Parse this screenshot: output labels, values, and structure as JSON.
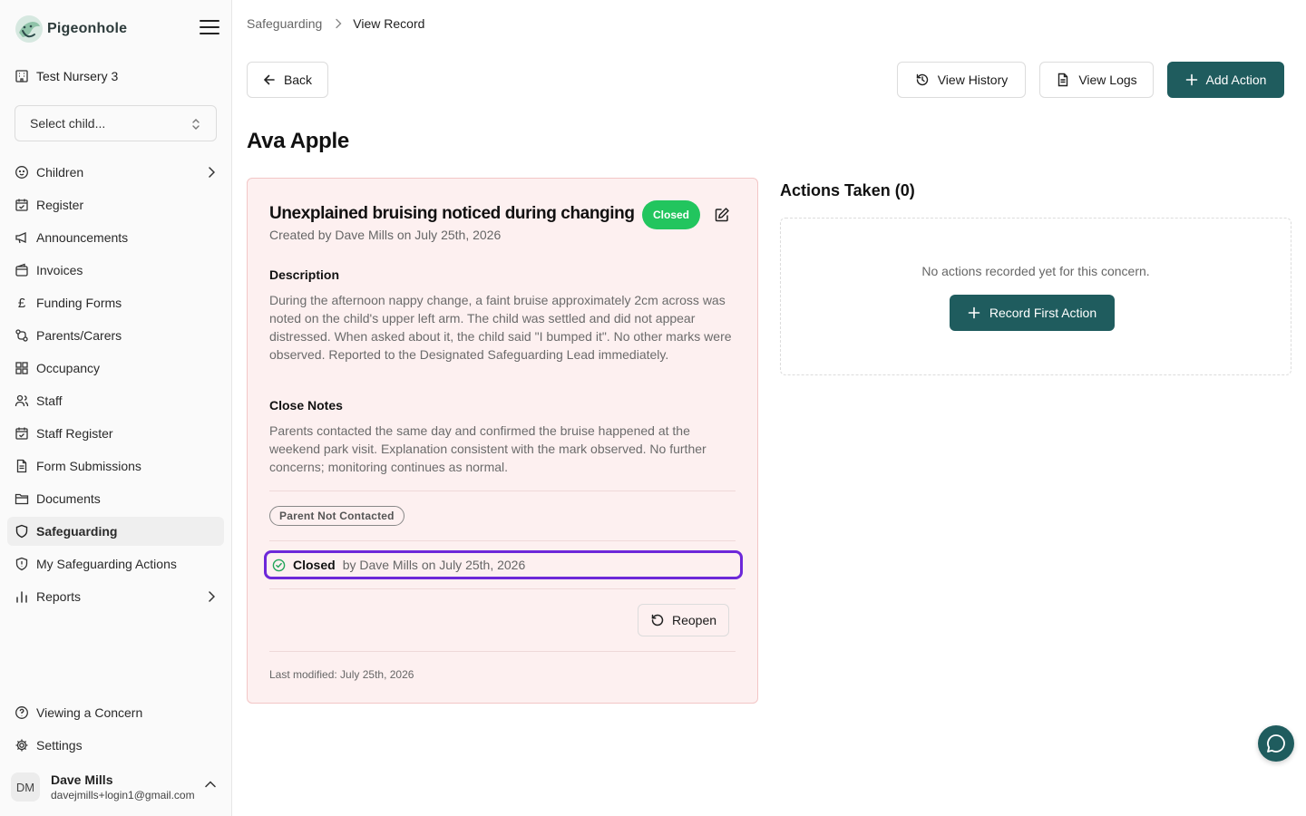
{
  "app": {
    "name": "Pigeonhole",
    "accent": "#1f5c5e"
  },
  "sidebar": {
    "nursery": "Test Nursery 3",
    "child_select_placeholder": "Select child...",
    "items": [
      {
        "label": "Children",
        "icon": "baby-icon",
        "has_submenu": true
      },
      {
        "label": "Register",
        "icon": "calendar-check-icon"
      },
      {
        "label": "Announcements",
        "icon": "megaphone-icon"
      },
      {
        "label": "Invoices",
        "icon": "wallet-icon"
      },
      {
        "label": "Funding Forms",
        "icon": "pound-icon"
      },
      {
        "label": "Parents/Carers",
        "icon": "connection-icon"
      },
      {
        "label": "Occupancy",
        "icon": "grid-icon"
      },
      {
        "label": "Staff",
        "icon": "users-icon"
      },
      {
        "label": "Staff Register",
        "icon": "calendar-check-icon"
      },
      {
        "label": "Form Submissions",
        "icon": "document-icon"
      },
      {
        "label": "Documents",
        "icon": "folder-icon"
      },
      {
        "label": "Safeguarding",
        "icon": "shield-icon",
        "active": true
      },
      {
        "label": "My Safeguarding Actions",
        "icon": "shield-alert-icon"
      },
      {
        "label": "Reports",
        "icon": "bar-chart-icon",
        "has_submenu": true
      }
    ],
    "bottom_items": [
      {
        "label": "Viewing a Concern",
        "icon": "help-circle-icon"
      },
      {
        "label": "Settings",
        "icon": "gear-icon"
      }
    ],
    "user": {
      "initials": "DM",
      "name": "Dave Mills",
      "email": "davejmills+login1@gmail.com"
    }
  },
  "breadcrumb": {
    "parent": "Safeguarding",
    "current": "View Record"
  },
  "toolbar": {
    "back_label": "Back",
    "history_label": "View History",
    "logs_label": "View Logs",
    "add_action_label": "Add Action"
  },
  "page": {
    "title": "Ava Apple"
  },
  "concern": {
    "title": "Unexplained bruising noticed during changing",
    "status": "Closed",
    "status_color": "#22c55e",
    "created": "Created by Dave Mills on July 25th, 2026",
    "description_heading": "Description",
    "description": "During the afternoon nappy change, a faint bruise approximately 2cm across was noted on the child's upper left arm. The child was settled and did not appear distressed. When asked about it, the child said \"I bumped it\". No other marks were observed. Reported to the Designated Safeguarding Lead immediately.",
    "close_notes_heading": "Close Notes",
    "close_notes": "Parents contacted the same day and confirmed the bruise happened at the weekend park visit. Explanation consistent with the mark observed. No further concerns; monitoring continues as normal.",
    "tag": "Parent Not Contacted",
    "closed_label": "Closed",
    "closed_by": "by Dave Mills on July 25th, 2026",
    "reopen_label": "Reopen",
    "last_modified": "Last modified: July 25th, 2026"
  },
  "actions": {
    "title": "Actions Taken (0)",
    "empty_message": "No actions recorded yet for this concern.",
    "record_first_label": "Record First Action"
  }
}
